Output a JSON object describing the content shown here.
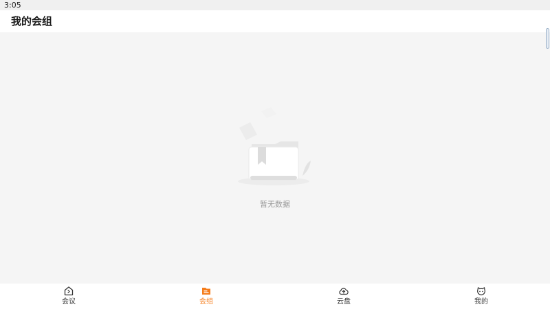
{
  "status_bar": {
    "time": "3:05"
  },
  "header": {
    "title": "我的会组"
  },
  "empty_state": {
    "message": "暂无数据",
    "illustration": "empty-folder-illustration"
  },
  "tabs": [
    {
      "label": "会议",
      "icon": "meeting-home-icon",
      "active": false
    },
    {
      "label": "会组",
      "icon": "group-folder-icon",
      "active": true
    },
    {
      "label": "云盘",
      "icon": "cloud-upload-icon",
      "active": false
    },
    {
      "label": "我的",
      "icon": "profile-face-icon",
      "active": false
    }
  ],
  "colors": {
    "accent": "#f57c1a",
    "background": "#f5f5f5",
    "muted_text": "#999999"
  }
}
